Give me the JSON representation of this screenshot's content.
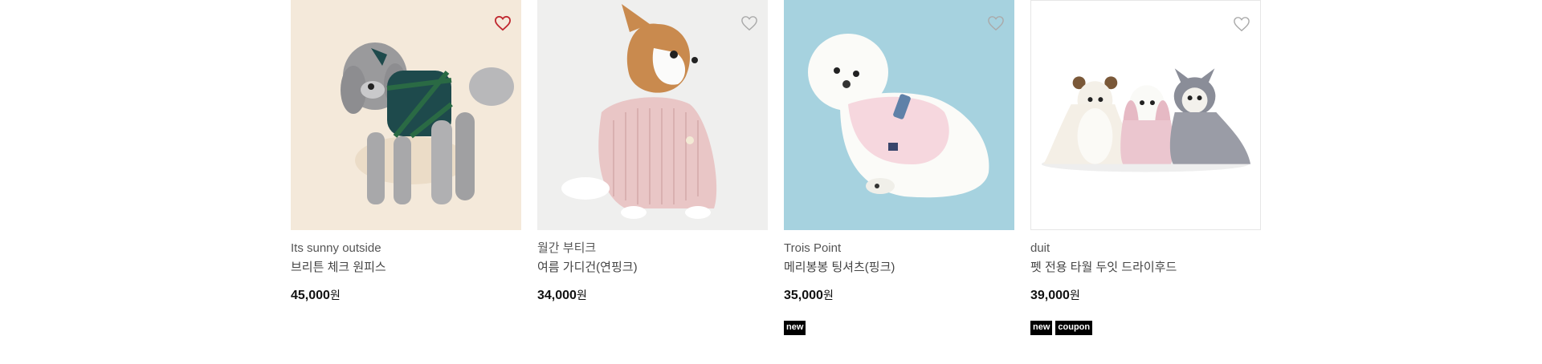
{
  "products": [
    {
      "brand": "Its sunny outside",
      "name": "브리튼 체크 원피스",
      "price": "45,000",
      "currency": "원",
      "badges": [],
      "liked": true,
      "image": "gray-poodle-plaid-dress"
    },
    {
      "brand": "월간 부티크",
      "name": "여름 가디건(연핑크)",
      "price": "34,000",
      "currency": "원",
      "badges": [],
      "liked": false,
      "image": "chihuahua-pink-cardigan"
    },
    {
      "brand": "Trois Point",
      "name": "메리봉봉 팅셔츠(핑크)",
      "price": "35,000",
      "currency": "원",
      "badges": [
        "new"
      ],
      "liked": false,
      "image": "bichon-pink-shirt"
    },
    {
      "brand": "duit",
      "name": "펫 전용 타월 두잇 드라이후드",
      "price": "39,000",
      "currency": "원",
      "badges": [
        "new",
        "coupon"
      ],
      "liked": false,
      "image": "three-dogs-towel-hoods"
    }
  ],
  "colors": {
    "liked_heart": "#c0282f",
    "heart_outline": "#aaaaaa",
    "badge_bg": "#000000"
  }
}
